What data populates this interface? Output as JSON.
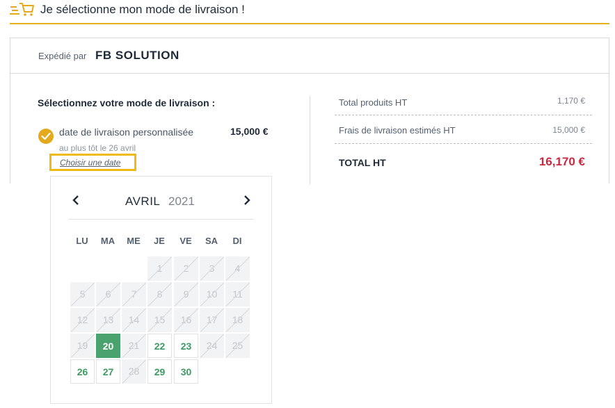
{
  "header": {
    "title": "Je sélectionne mon mode de livraison !",
    "icon": "cart-icon",
    "accent": "#e4b21a"
  },
  "seller": {
    "prefix": "Expédié par",
    "name": "FB SOLUTION"
  },
  "delivery": {
    "section_title": "Sélectionnez votre mode de livraison :",
    "option_label": "date de livraison personnalisée",
    "option_price": "15,000 €",
    "option_sub": "au plus tôt le 26 avril",
    "choose_link": "Choisir une date"
  },
  "summary": {
    "products_label": "Total produits HT",
    "products_value": "1,170 €",
    "shipping_label": "Frais de livraison estimés HT",
    "shipping_value": "15,000 €",
    "total_label": "TOTAL HT",
    "total_value": "16,170 €",
    "total_color": "#c8293f"
  },
  "calendar": {
    "month": "AVRIL",
    "year": "2021",
    "prev_icon": "chevron-left-icon",
    "next_icon": "chevron-right-icon",
    "weekdays": [
      "LU",
      "MA",
      "ME",
      "JE",
      "VE",
      "SA",
      "DI"
    ],
    "weeks": [
      [
        null,
        null,
        null,
        {
          "d": "1",
          "s": "disabled"
        },
        {
          "d": "2",
          "s": "disabled"
        },
        {
          "d": "3",
          "s": "disabled"
        },
        {
          "d": "4",
          "s": "disabled"
        }
      ],
      [
        {
          "d": "5",
          "s": "disabled"
        },
        {
          "d": "6",
          "s": "disabled"
        },
        {
          "d": "7",
          "s": "disabled"
        },
        {
          "d": "8",
          "s": "disabled"
        },
        {
          "d": "9",
          "s": "disabled"
        },
        {
          "d": "10",
          "s": "disabled"
        },
        {
          "d": "11",
          "s": "disabled"
        }
      ],
      [
        {
          "d": "12",
          "s": "disabled"
        },
        {
          "d": "13",
          "s": "disabled"
        },
        {
          "d": "14",
          "s": "disabled"
        },
        {
          "d": "15",
          "s": "disabled"
        },
        {
          "d": "16",
          "s": "disabled"
        },
        {
          "d": "17",
          "s": "disabled"
        },
        {
          "d": "18",
          "s": "disabled"
        }
      ],
      [
        {
          "d": "19",
          "s": "disabled"
        },
        {
          "d": "20",
          "s": "selected"
        },
        {
          "d": "21",
          "s": "disabled"
        },
        {
          "d": "22",
          "s": "available"
        },
        {
          "d": "23",
          "s": "available"
        },
        {
          "d": "24",
          "s": "disabled"
        },
        {
          "d": "25",
          "s": "disabled"
        }
      ],
      [
        {
          "d": "26",
          "s": "available"
        },
        {
          "d": "27",
          "s": "available"
        },
        {
          "d": "28",
          "s": "disabled"
        },
        {
          "d": "29",
          "s": "available"
        },
        {
          "d": "30",
          "s": "available"
        },
        null,
        null
      ]
    ],
    "available_color": "#3c9a63",
    "selected_color": "#4aa26e"
  }
}
